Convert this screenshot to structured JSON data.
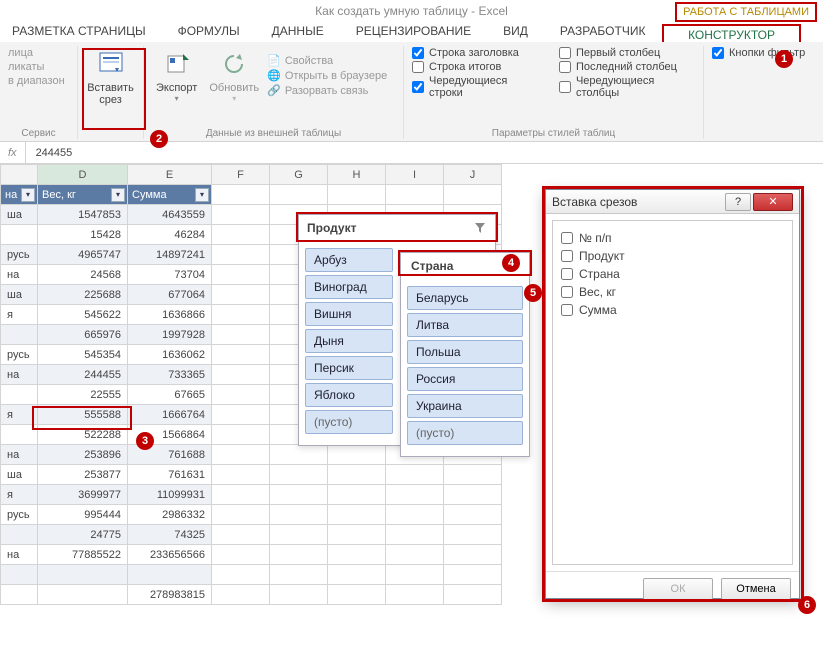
{
  "title": "Как создать умную таблицу - Excel",
  "tool_context": "РАБОТА С ТАБЛИЦАМИ",
  "tabs": [
    "РАЗМЕТКА СТРАНИЦЫ",
    "ФОРМУЛЫ",
    "ДАННЫЕ",
    "РЕЦЕНЗИРОВАНИЕ",
    "ВИД",
    "РАЗРАБОТЧИК"
  ],
  "design_tab": "КОНСТРУКТОР",
  "ribbon": {
    "tools_left": {
      "l1": "лица",
      "l2": "ликаты",
      "l3": "в диапазон",
      "group": "Сервис"
    },
    "insert_slicer": "Вставить\nсрез",
    "export": "Экспорт",
    "refresh": "Обновить",
    "ext_props": "Свойства",
    "ext_open": "Открыть в браузере",
    "ext_unlink": "Разорвать связь",
    "ext_group": "Данные из внешней таблицы",
    "opt_header": "Строка заголовка",
    "opt_total": "Строка итогов",
    "opt_banded_rows": "Чередующиеся строки",
    "opt_first_col": "Первый столбец",
    "opt_last_col": "Последний столбец",
    "opt_banded_cols": "Чередующиеся столбцы",
    "opt_filter_btn": "Кнопки фильтр",
    "styles_group": "Параметры стилей таблиц"
  },
  "fbar": {
    "fx": "fx",
    "value": "244455"
  },
  "cols": [
    " ",
    "D",
    "E",
    "F",
    "G",
    "H",
    "I",
    "J"
  ],
  "headers": {
    "c0": "на",
    "c1": "Вес, кг",
    "c2": "Сумма"
  },
  "rows": [
    {
      "a": "ша",
      "d": "1547853",
      "e": "4643559"
    },
    {
      "a": "",
      "d": "15428",
      "e": "46284"
    },
    {
      "a": "русь",
      "d": "4965747",
      "e": "14897241"
    },
    {
      "a": "на",
      "d": "24568",
      "e": "73704"
    },
    {
      "a": "ша",
      "d": "225688",
      "e": "677064"
    },
    {
      "a": "я",
      "d": "545622",
      "e": "1636866"
    },
    {
      "a": "",
      "d": "665976",
      "e": "1997928"
    },
    {
      "a": "русь",
      "d": "545354",
      "e": "1636062"
    },
    {
      "a": "на",
      "d": "244455",
      "e": "733365"
    },
    {
      "a": "",
      "d": "22555",
      "e": "67665"
    },
    {
      "a": "я",
      "d": "555588",
      "e": "1666764"
    },
    {
      "a": "",
      "d": "522288",
      "e": "1566864"
    },
    {
      "a": "на",
      "d": "253896",
      "e": "761688"
    },
    {
      "a": "ша",
      "d": "253877",
      "e": "761631"
    },
    {
      "a": "я",
      "d": "3699977",
      "e": "11099931"
    },
    {
      "a": "русь",
      "d": "995444",
      "e": "2986332"
    },
    {
      "a": "",
      "d": "24775",
      "e": "74325"
    },
    {
      "a": "на",
      "d": "77885522",
      "e": "233656566"
    },
    {
      "a": "",
      "d": "",
      "e": ""
    },
    {
      "a": "",
      "d": "",
      "e": "278983815"
    }
  ],
  "slicer1": {
    "title": "Продукт",
    "items": [
      "Арбуз",
      "Виноград",
      "Вишня",
      "Дыня",
      "Персик",
      "Яблоко",
      "(пусто)"
    ]
  },
  "slicer2": {
    "title": "Страна",
    "items": [
      "Беларусь",
      "Литва",
      "Польша",
      "Россия",
      "Украина",
      "(пусто)"
    ]
  },
  "dialog": {
    "title": "Вставка срезов",
    "fields": [
      "№ п/п",
      "Продукт",
      "Страна",
      "Вес, кг",
      "Сумма"
    ],
    "ok": "ОК",
    "cancel": "Отмена",
    "help": "?",
    "close": "✕"
  },
  "chart_data": {
    "type": "table",
    "columns": [
      "на",
      "Вес, кг",
      "Сумма"
    ],
    "rows": [
      [
        "ша",
        1547853,
        4643559
      ],
      [
        "",
        15428,
        46284
      ],
      [
        "русь",
        4965747,
        14897241
      ],
      [
        "на",
        24568,
        73704
      ],
      [
        "ша",
        225688,
        677064
      ],
      [
        "я",
        545622,
        1636866
      ],
      [
        "",
        665976,
        1997928
      ],
      [
        "русь",
        545354,
        1636062
      ],
      [
        "на",
        244455,
        733365
      ],
      [
        "",
        22555,
        67665
      ],
      [
        "я",
        555588,
        1666764
      ],
      [
        "",
        522288,
        1566864
      ],
      [
        "на",
        253896,
        761688
      ],
      [
        "ша",
        253877,
        761631
      ],
      [
        "я",
        3699977,
        11099931
      ],
      [
        "русь",
        995444,
        2986332
      ],
      [
        "",
        24775,
        74325
      ],
      [
        "на",
        77885522,
        233656566
      ]
    ],
    "total_sum": 278983815
  }
}
